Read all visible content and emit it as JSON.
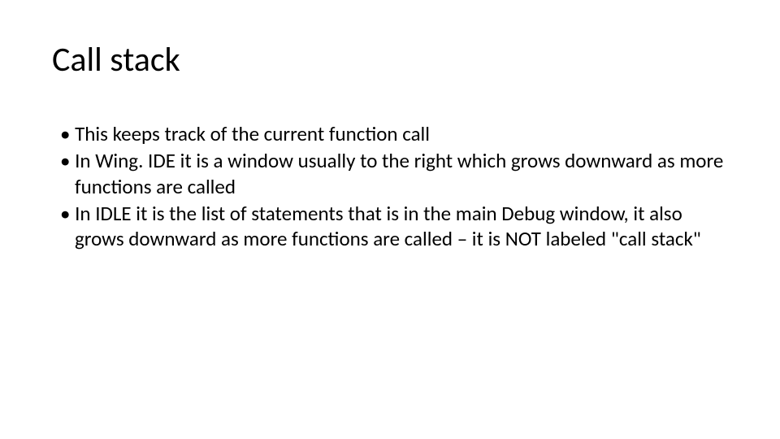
{
  "slide": {
    "title": "Call stack",
    "bullets": [
      "This keeps track of the current function call",
      "In Wing. IDE it is a window usually to the right which grows downward as more functions are called",
      "In IDLE it is the list of statements that is in the main Debug window, it also grows downward as more functions are called – it is NOT labeled \"call stack\""
    ]
  }
}
